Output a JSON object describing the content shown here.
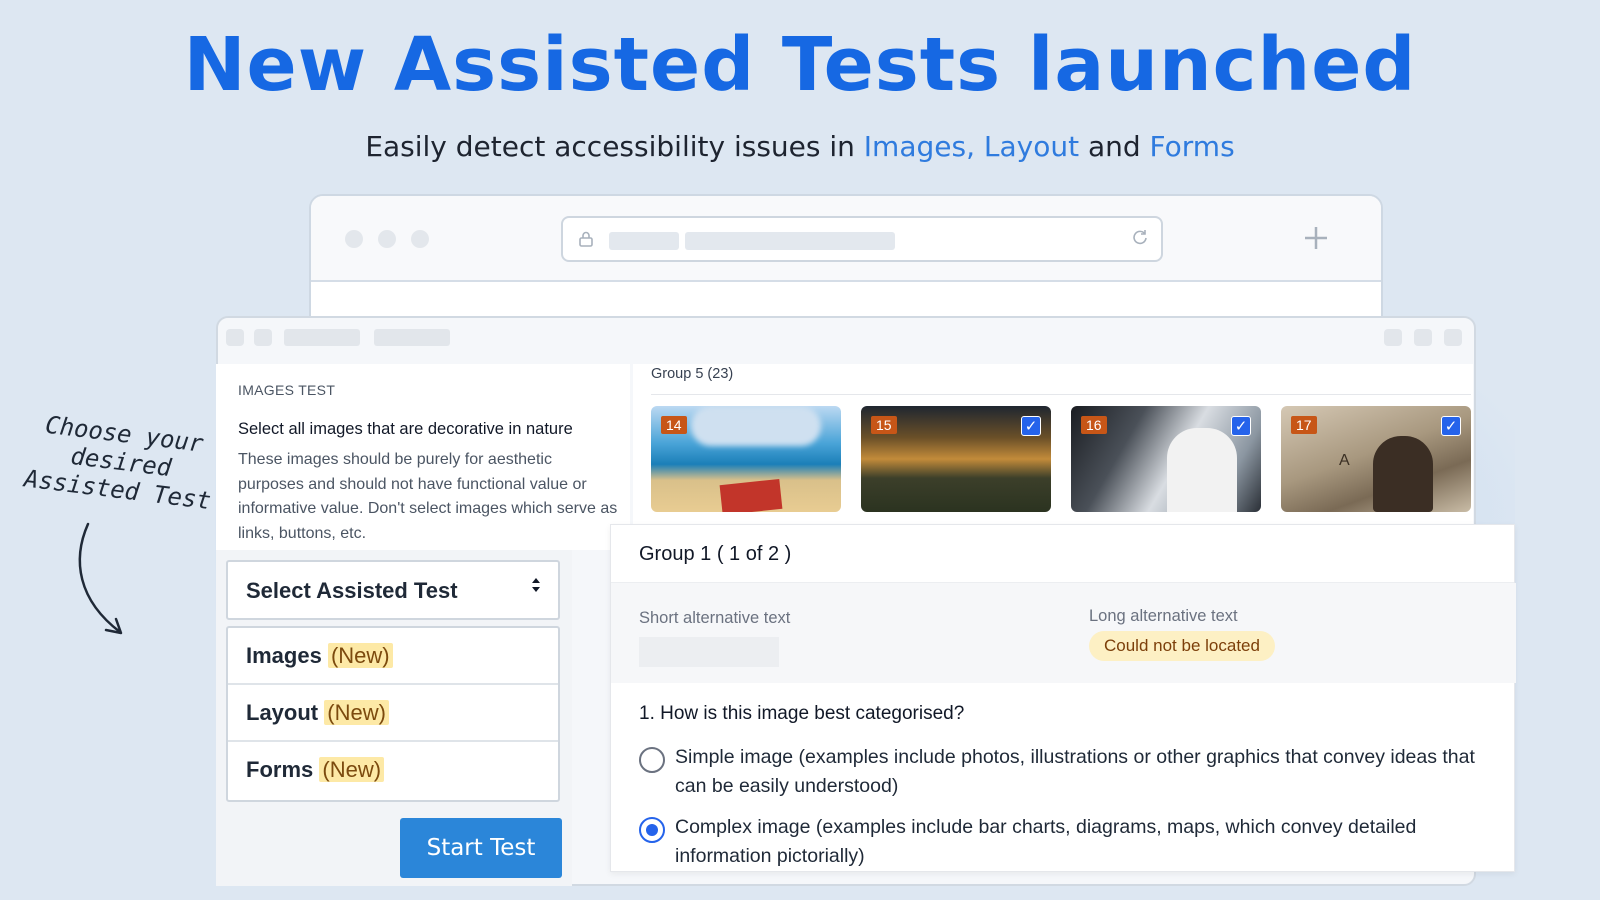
{
  "hero": {
    "title": "New Assisted Tests launched",
    "subtitle_prefix": "Easily detect accessibility issues in ",
    "subtitle_hl1": "Images, Layout",
    "subtitle_mid": " and ",
    "subtitle_hl2": "Forms"
  },
  "note": {
    "line1": "Choose your",
    "line2": "desired",
    "line3": "Assisted Test"
  },
  "images_test": {
    "label": "IMAGES TEST",
    "instruction_title": "Select all images that are decorative in nature",
    "instruction_body": "These images should be purely for aesthetic purposes and should not have functional value or informative value. Don't select images which serve as links, buttons, etc."
  },
  "group5": {
    "title": "Group 5 (23)",
    "thumbs": [
      {
        "num": "14",
        "checked": false
      },
      {
        "num": "15",
        "checked": true
      },
      {
        "num": "16",
        "checked": true
      },
      {
        "num": "17",
        "checked": true,
        "letter": "A"
      }
    ]
  },
  "card": {
    "title": "Group 1 ( 1 of 2 )",
    "short_alt_label": "Short alternative text",
    "long_alt_label": "Long alternative text",
    "long_alt_badge": "Could not be located",
    "question": "1. How is this image best categorised?",
    "option1": "Simple image (examples include photos, illustrations or other graphics that convey ideas that can be easily understood)",
    "option2": "Complex image (examples include bar charts, diagrams, maps, which convey detailed information pictorially)",
    "selected_option": 2
  },
  "dropdown": {
    "select_label": "Select Assisted Test",
    "options": [
      {
        "name": "Images",
        "tag": "(New)"
      },
      {
        "name": "Layout",
        "tag": "(New)"
      },
      {
        "name": "Forms",
        "tag": "(New)"
      }
    ],
    "start_button": "Start Test"
  },
  "colors": {
    "accent": "#1668e3",
    "button": "#2b86d9",
    "badge_bg": "#fdf0c4",
    "new_tag_bg": "#fde9a6",
    "thumb_num_bg": "#c75617"
  },
  "icons": [
    "lock-icon",
    "reload-icon",
    "plus-icon",
    "checkbox-checked-icon",
    "sort-arrows-icon",
    "curved-arrow-icon"
  ]
}
